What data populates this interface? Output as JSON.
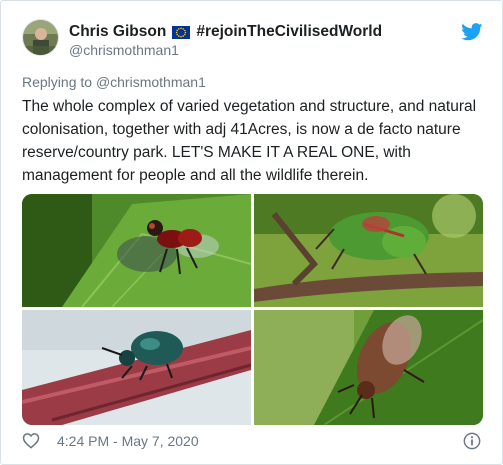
{
  "author": {
    "display_name": "Chris Gibson",
    "flag_icon": "eu-flag-icon",
    "hashtag": "#rejoinTheCivilisedWorld",
    "handle": "@chrismothman1"
  },
  "reply": {
    "prefix": "Replying to ",
    "to_handle": "@chrismothman1"
  },
  "tweet": {
    "text": "The whole complex of varied vegetation and structure, and natural colonisation, together with adj 41Acres, is now a de facto nature reserve/country park. LET'S MAKE IT A REAL ONE, with management for people and all the wildlife therein."
  },
  "media": {
    "photos": [
      {
        "subject": "fly on a leaf"
      },
      {
        "subject": "green shield bug on a branch"
      },
      {
        "subject": "green beetle on a red stem"
      },
      {
        "subject": "brown bug on a leaf"
      }
    ]
  },
  "footer": {
    "timestamp": "4:24 PM - May 7, 2020",
    "like_icon": "heart-icon",
    "info_icon": "info-icon"
  },
  "colors": {
    "text": "#1c2022",
    "muted": "#697882",
    "twitter_blue": "#1da1f2",
    "border": "#d9e1e6"
  }
}
